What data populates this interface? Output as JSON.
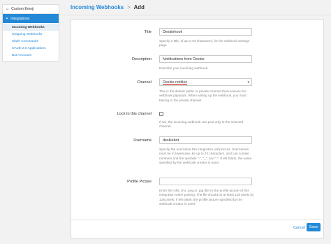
{
  "sidebar": {
    "categories": [
      {
        "label": "Custom Emoji",
        "icon": "smile-icon"
      },
      {
        "label": "Integrations",
        "icon": "link-icon"
      }
    ],
    "items": [
      {
        "label": "Incoming Webhooks"
      },
      {
        "label": "Outgoing Webhooks"
      },
      {
        "label": "Slash Commands"
      },
      {
        "label": "OAuth 2.0 Applications"
      },
      {
        "label": "Bot Accounts"
      }
    ]
  },
  "header": {
    "crumb": "Incoming Webhooks",
    "separator": ">",
    "current": "Add"
  },
  "form": {
    "title": {
      "label": "Title",
      "value": "Deskiehook",
      "help": "Specify a title, of up to 64 characters, for the webhook settings page."
    },
    "description": {
      "label": "Description",
      "value": "Notifications from Deskie",
      "help": "Describe your incoming webhook."
    },
    "channel": {
      "label": "Channel",
      "value": "Deskie notifies",
      "help": "This is the default public or private channel that receives the webhook payloads. When setting up the webhook, you must belong to the private channel."
    },
    "lock": {
      "label": "Lock to this channel",
      "help": "If set, the incoming webhook can post only to the selected channel."
    },
    "username": {
      "label": "Username",
      "value": "deskiebot",
      "help": "Specify the username this integration will post as. Usernames must be in lowercase, be up to 22 characters, and can contain numbers and the symbols \"-\", \"_\", and \".\". If left blank, the name specified by the webhook creator is used."
    },
    "profile_picture": {
      "label": "Profile Picture",
      "value": "",
      "help": "Enter the URL of a .png or .jpg file for the profile picture of this integration when posting. The file should be at least 128 pixels by 128 pixels. If left blank, the profile picture specified by the webhook creator is used."
    }
  },
  "actions": {
    "cancel": "Cancel",
    "save": "Save"
  },
  "colors": {
    "accent": "#2389d7",
    "underline": "#d9342b"
  }
}
